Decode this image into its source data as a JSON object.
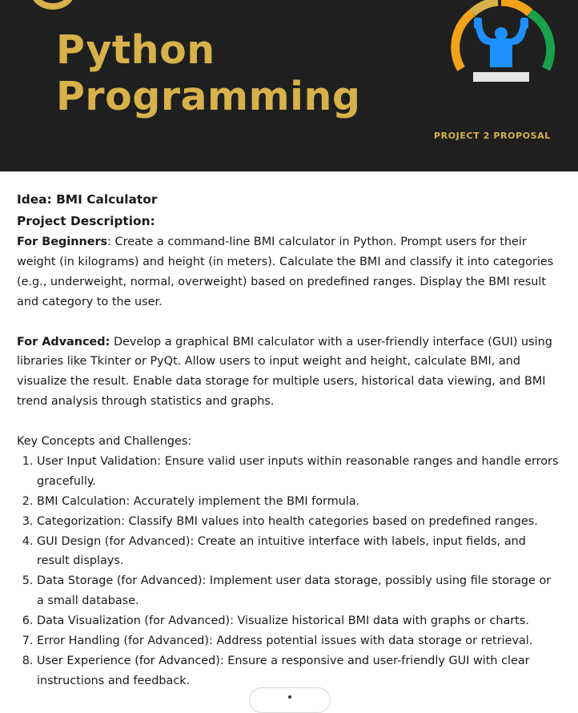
{
  "banner": {
    "title_line1": "Python",
    "title_line2": "Programming",
    "subtitle": "PROJECT 2 PROPOSAL",
    "colors": {
      "background": "#1f1f1f",
      "gold": "#d7b24a",
      "blue": "#1e90ff",
      "green": "#19a24a",
      "orange": "#f2a31b"
    },
    "logo_icon": "weightlifter-gauge-icon"
  },
  "doc": {
    "idea": "Idea: BMI Calculator",
    "desc_heading": "Project Description:",
    "beginners_label": "For Beginners",
    "beginners_text": ": Create a command-line BMI calculator in Python. Prompt users for their weight (in kilograms) and height (in meters). Calculate the BMI and classify it into categories (e.g., underweight, normal, overweight) based on predefined ranges. Display the BMI result and category to the user.",
    "advanced_label": "For Advanced:",
    "advanced_text": " Develop a graphical BMI calculator with a user-friendly interface (GUI) using libraries like Tkinter or PyQt. Allow users to input weight and height, calculate BMI, and visualize the result. Enable data storage for multiple users, historical data viewing, and BMI trend analysis through statistics and graphs.",
    "concepts_heading": "Key Concepts and Challenges:",
    "concepts": [
      "User Input Validation: Ensure valid user inputs within reasonable ranges and handle errors gracefully.",
      "BMI Calculation: Accurately implement the BMI formula.",
      "Categorization: Classify BMI values into health categories based on predefined ranges.",
      "GUI Design (for Advanced): Create an intuitive interface with labels, input fields, and result displays.",
      "Data Storage (for Advanced): Implement user data storage, possibly using file storage or a small database.",
      "Data Visualization (for Advanced): Visualize historical BMI data with graphs or charts.",
      "Error Handling (for Advanced): Address potential issues with data storage or retrieval.",
      "User Experience (for Advanced): Ensure a responsive and user-friendly GUI with clear instructions and feedback."
    ]
  }
}
